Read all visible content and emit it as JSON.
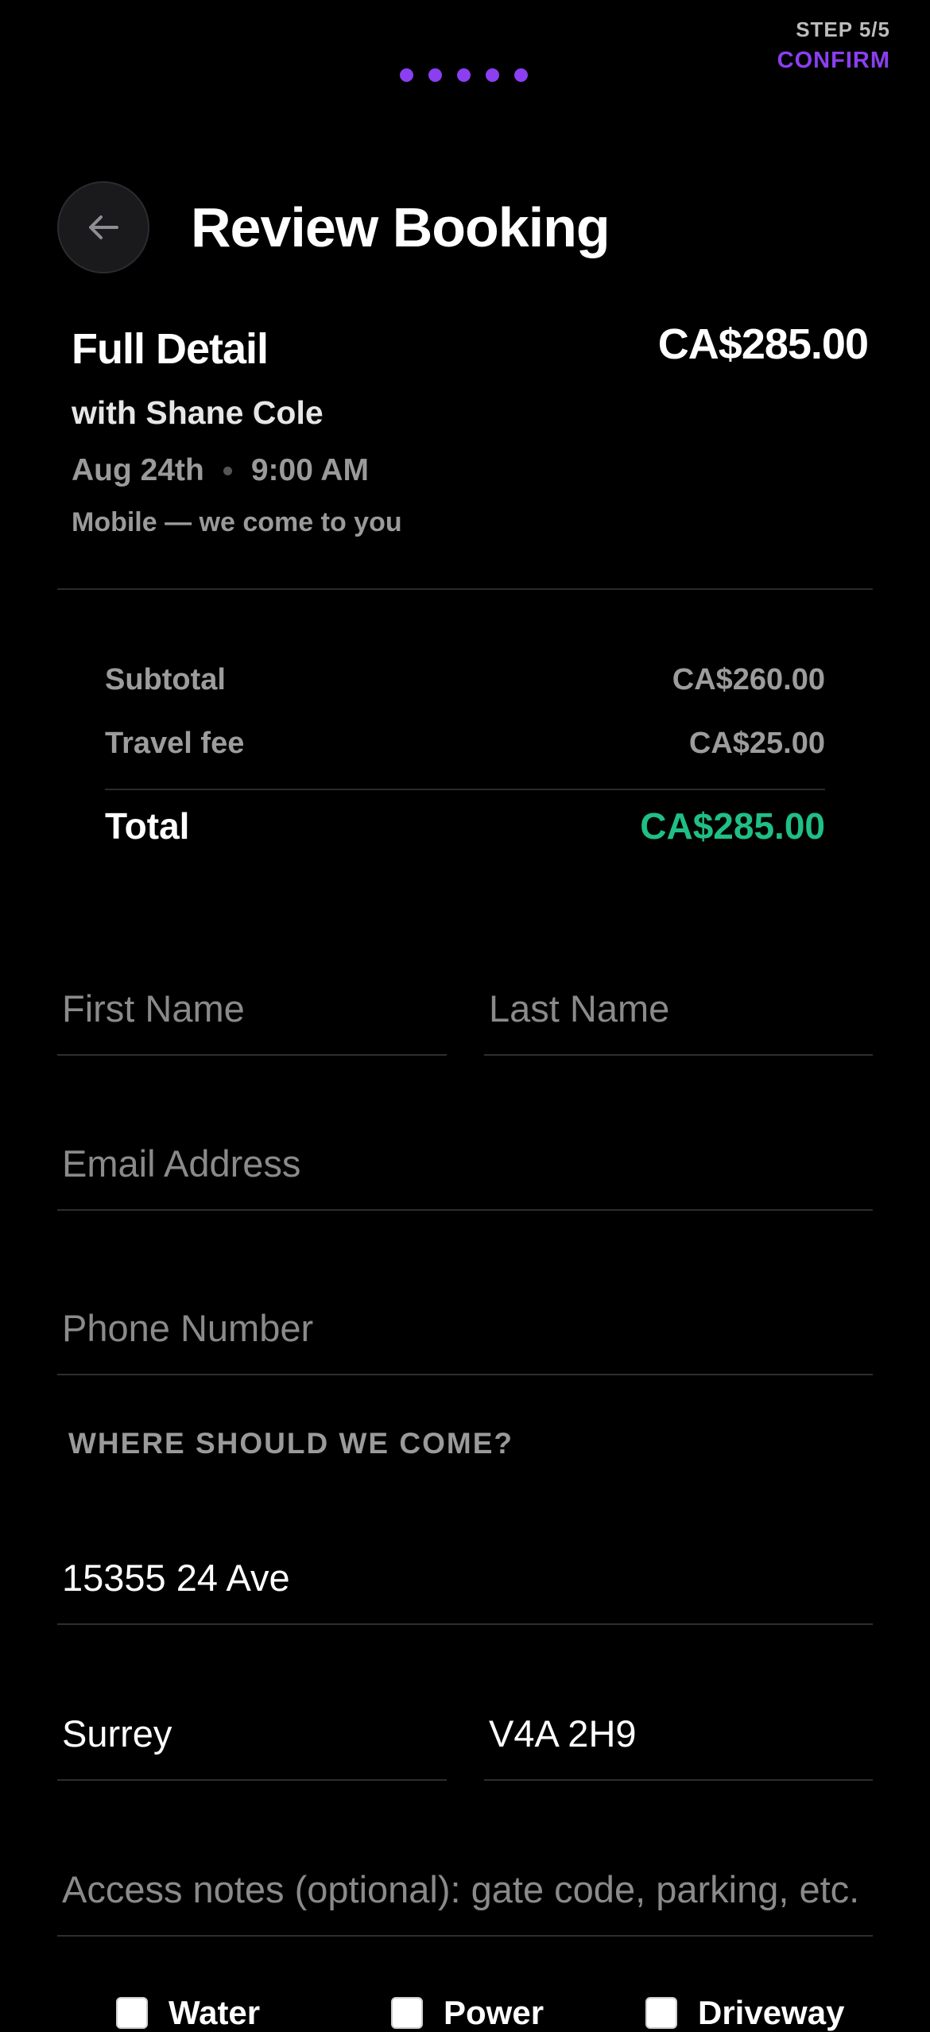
{
  "progress": {
    "step_label": "STEP 5/5",
    "step_name": "CONFIRM",
    "current_step": 5,
    "total_steps": 5,
    "accent_color": "#8b3ff0"
  },
  "header": {
    "back_icon": "arrow-left-icon",
    "title": "Review Booking"
  },
  "service": {
    "name": "Full Detail",
    "price": "CA$285.00",
    "provider": "with Shane Cole",
    "date": "Aug 24th",
    "time": "9:00 AM",
    "location_type": "Mobile — we come to you"
  },
  "breakdown": {
    "subtotal_label": "Subtotal",
    "subtotal_value": "CA$260.00",
    "travel_label": "Travel fee",
    "travel_value": "CA$25.00",
    "total_label": "Total",
    "total_value": "CA$285.00",
    "total_color": "#1fbf85"
  },
  "form": {
    "first_name": {
      "placeholder": "First Name",
      "value": ""
    },
    "last_name": {
      "placeholder": "Last Name",
      "value": ""
    },
    "email": {
      "placeholder": "Email Address",
      "value": ""
    },
    "phone": {
      "placeholder": "Phone Number",
      "value": ""
    },
    "address_section_label": "WHERE SHOULD WE COME?",
    "street": {
      "placeholder": "",
      "value": "15355 24 Ave"
    },
    "city": {
      "placeholder": "",
      "value": "Surrey"
    },
    "postal": {
      "placeholder": "",
      "value": "V4A 2H9"
    },
    "access_notes": {
      "placeholder": "Access notes (optional): gate code, parking, etc.",
      "value": ""
    }
  },
  "amenities": [
    {
      "label": "Water",
      "checked": false
    },
    {
      "label": "Power",
      "checked": false
    },
    {
      "label": "Driveway",
      "checked": false
    }
  ]
}
